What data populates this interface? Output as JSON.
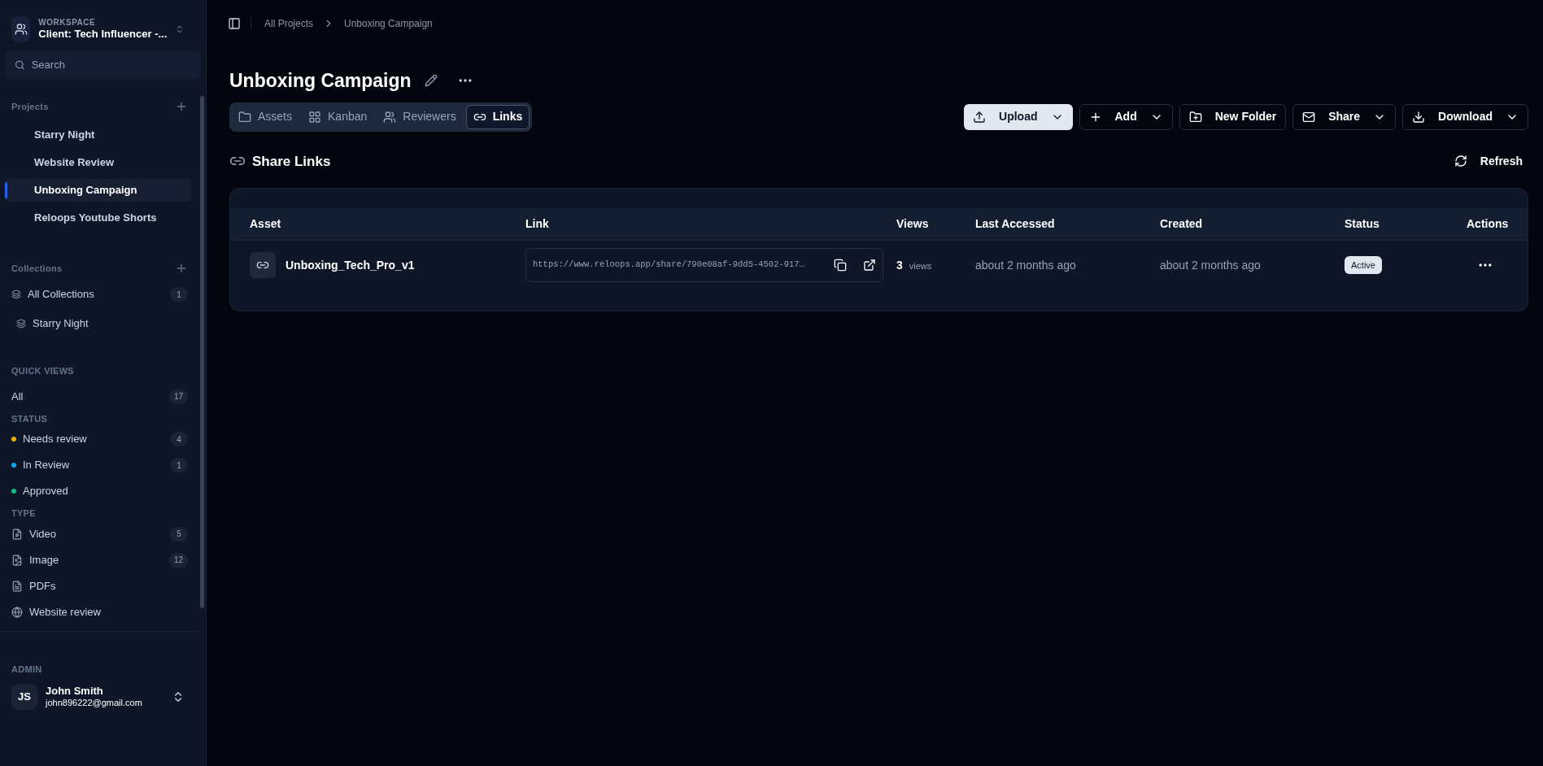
{
  "workspace": {
    "label": "WORKSPACE",
    "name": "Client: Tech Influencer -..."
  },
  "search": {
    "placeholder": "Search"
  },
  "projects": {
    "title": "Projects",
    "items": [
      {
        "label": "Starry Night",
        "selected": false
      },
      {
        "label": "Website Review",
        "selected": false
      },
      {
        "label": "Unboxing Campaign",
        "selected": true
      },
      {
        "label": "Reloops Youtube Shorts",
        "selected": false
      }
    ]
  },
  "collections": {
    "title": "Collections",
    "items": [
      {
        "label": "All Collections",
        "count": "1",
        "kind": "all"
      },
      {
        "label": "Starry Night",
        "kind": "item"
      }
    ]
  },
  "quick_views": {
    "title": "QUICK VIEWS",
    "all": {
      "label": "All",
      "count": "17"
    },
    "status_title": "STATUS",
    "status": [
      {
        "label": "Needs review",
        "count": "4",
        "color": "#eab308"
      },
      {
        "label": "In Review",
        "count": "1",
        "color": "#0ea5e9"
      },
      {
        "label": "Approved",
        "color": "#10b981"
      }
    ],
    "type_title": "TYPE",
    "types": [
      {
        "label": "Video",
        "count": "5",
        "kind": "video"
      },
      {
        "label": "Image",
        "count": "12",
        "kind": "image"
      },
      {
        "label": "PDFs",
        "kind": "pdf"
      },
      {
        "label": "Website review",
        "kind": "web"
      }
    ]
  },
  "admin": {
    "title": "ADMIN",
    "initials": "JS",
    "name": "John Smith",
    "email": "john896222@gmail.com"
  },
  "breadcrumb": [
    "All Projects",
    "Unboxing Campaign"
  ],
  "title": "Unboxing Campaign",
  "tabs": [
    {
      "label": "Assets",
      "kind": "folder",
      "selected": false
    },
    {
      "label": "Kanban",
      "kind": "grid",
      "selected": false
    },
    {
      "label": "Reviewers",
      "kind": "users",
      "selected": false
    },
    {
      "label": "Links",
      "kind": "link",
      "selected": true
    }
  ],
  "actions": [
    {
      "label": "Upload",
      "kind": "upload",
      "primary": true,
      "dropdown": true
    },
    {
      "label": "Add",
      "kind": "plus",
      "primary": false,
      "dropdown": true
    },
    {
      "label": "New Folder",
      "kind": "folder",
      "primary": false,
      "dropdown": false
    },
    {
      "label": "Share",
      "kind": "mail",
      "primary": false,
      "dropdown": true
    },
    {
      "label": "Download",
      "kind": "download",
      "primary": false,
      "dropdown": true
    }
  ],
  "section": {
    "title": "Share Links",
    "refresh": "Refresh"
  },
  "table": {
    "columns": [
      "Asset",
      "Link",
      "Views",
      "Last Accessed",
      "Created",
      "Status",
      "Actions"
    ],
    "rows": [
      {
        "asset": "Unboxing_Tech_Pro_v1",
        "link": "https://www.reloops.app/share/790e08af-9dd5-4502-917…",
        "views": "3",
        "views_unit": "views",
        "last_accessed": "about 2 months ago",
        "created": "about 2 months ago",
        "status": "Active"
      }
    ]
  }
}
